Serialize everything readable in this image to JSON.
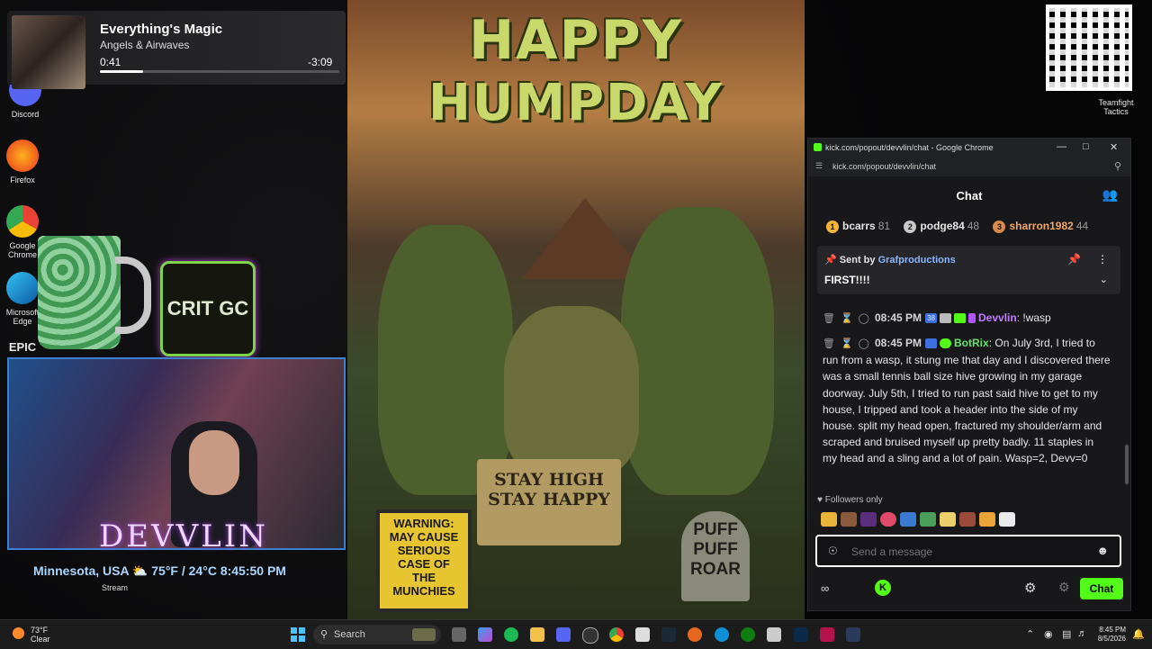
{
  "desktop": {
    "icons": [
      {
        "label": "Discord"
      },
      {
        "label": "Firefox"
      },
      {
        "label": "Google Chrome"
      },
      {
        "label": "Microsoft Edge"
      },
      {
        "label": "EPIC"
      },
      {
        "label": "Teamfight Tactics"
      },
      {
        "label": "Stream"
      }
    ]
  },
  "now_playing": {
    "title": "Everything's Magic",
    "artist": "Angels & Airwaves",
    "elapsed": "0:41",
    "remaining": "-3:09",
    "progress_fraction": 0.18
  },
  "overlay": {
    "crit_logo": "CRIT GC",
    "streamer_name": "DEVVLIN",
    "location_weather": "Minnesota, USA ⛅ 75°F / 24°C  8:45:50 PM"
  },
  "poster": {
    "title_line1": "HAPPY",
    "title_line2": "HUMPDAY",
    "sign_stay": "STAY HIGH\nSTAY HAPPY",
    "sign_warning": "WARNING:\nMAY CAUSE\nSERIOUS\nCASE OF\nTHE MUNCHIES",
    "sign_puff": "PUFF\nPUFF\nROAR"
  },
  "chrome": {
    "window_title": "kick.com/popout/devvlin/chat - Google Chrome",
    "url": "kick.com/popout/devvlin/chat"
  },
  "chat": {
    "header_title": "Chat",
    "leaderboard": [
      {
        "rank": "1",
        "name": "bcarrs",
        "count": "81",
        "color": "#f4b63a"
      },
      {
        "rank": "2",
        "name": "podge84",
        "count": "48",
        "color": "#c9c9c9"
      },
      {
        "rank": "3",
        "name": "sharron1982",
        "count": "44",
        "color": "#d98a4a"
      }
    ],
    "pinned": {
      "sent_by_label": "Sent by",
      "sender": "Grafproductions",
      "message": "FIRST!!!!"
    },
    "messages": [
      {
        "time": "08:45 PM",
        "badge": "38",
        "user": "Devvlin",
        "text": ": !wasp"
      },
      {
        "time": "08:45 PM",
        "user": "BotRix",
        "text": ": On July 3rd, I tried to run from a wasp, it stung me that day and I discovered there was a small tennis ball size hive growing in my garage doorway. July 5th, I tried to run past said hive to get to my house, I tripped and took a header into the side of my house. split my head open, fractured my shoulder/arm and scraped and bruised myself up pretty badly. 11 staples in my head and a sling and a lot of pain. Wasp=2, Devv=0"
      }
    ],
    "followers_only": "Followers only",
    "send_placeholder": "Send a message",
    "chat_button": "Chat"
  },
  "taskbar": {
    "weather_temp": "73°F",
    "weather_desc": "Clear",
    "search_placeholder": "Search",
    "time": "8:45 PM",
    "date": "8/5/2026"
  },
  "colors": {
    "kick_green": "#53fc18",
    "chat_bg": "#18181b",
    "devvlin_purple": "#c37bff",
    "botrix_green": "#66e26c"
  }
}
